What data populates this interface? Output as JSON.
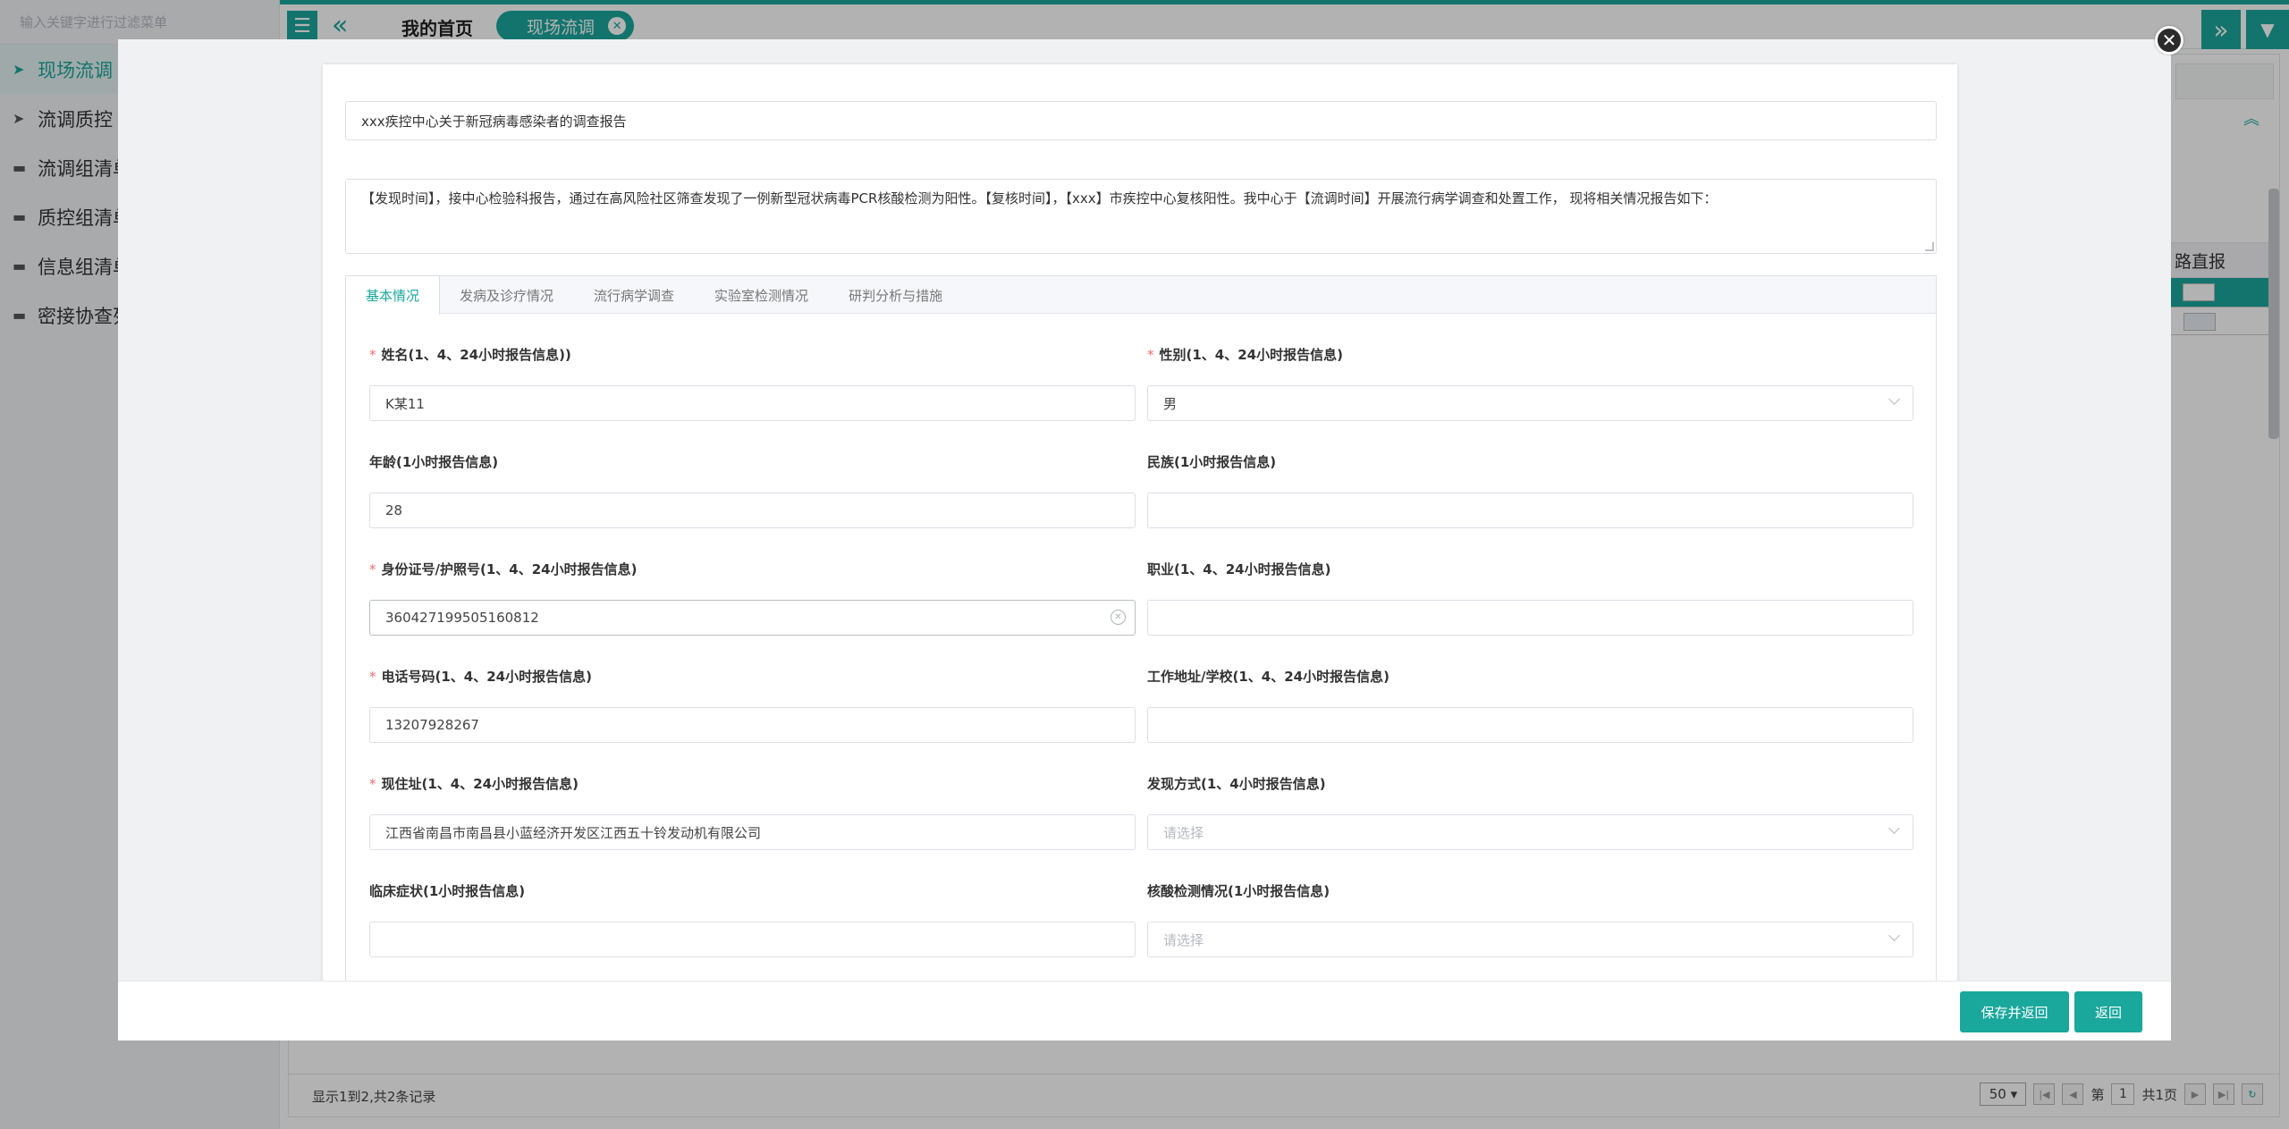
{
  "sidebar": {
    "search_placeholder": "输入关键字进行过滤菜单",
    "items": [
      {
        "label": "现场流调"
      },
      {
        "label": "流调质控"
      },
      {
        "label": "流调组清单"
      },
      {
        "label": "质控组清单"
      },
      {
        "label": "信息组清单"
      },
      {
        "label": "密接协查列"
      }
    ]
  },
  "topbar": {
    "home_tab": "我的首页",
    "active_tab": "现场流调",
    "menu_icon": "☰",
    "back_icon": "«",
    "fwd_icon": "»",
    "dropdown_icon": "▼"
  },
  "background_table": {
    "header_fragment": "路直报"
  },
  "background_footer": {
    "info": "显示1到2,共2条记录",
    "page_size": "50",
    "page_prefix": "第",
    "page_num": "1",
    "page_suffix": "共1页"
  },
  "modal": {
    "title_value": "xxx疾控中心关于新冠病毒感染者的调查报告",
    "intro_value": "【发现时间】，接中心检验科报告，通过在高风险社区筛查发现了一例新型冠状病毒PCR核酸检测为阳性。【复核时间】，【xxx】市疾控中心复核阳性。我中心于【流调时间】开展流行病学调查和处置工作， 现将相关情况报告如下：",
    "tabs": [
      {
        "label": "基本情况"
      },
      {
        "label": "发病及诊疗情况"
      },
      {
        "label": "流行病学调查"
      },
      {
        "label": "实验室检测情况"
      },
      {
        "label": "研判分析与措施"
      }
    ],
    "fields": {
      "name": {
        "label": "姓名(1、4、24小时报告信息))",
        "value": "K某11"
      },
      "gender": {
        "label": "性别(1、4、24小时报告信息)",
        "value": "男"
      },
      "age": {
        "label": "年龄(1小时报告信息)",
        "value": "28"
      },
      "ethnicity": {
        "label": "民族(1小时报告信息)",
        "value": ""
      },
      "id_number": {
        "label": "身份证号/护照号(1、4、24小时报告信息)",
        "value": "360427199505160812"
      },
      "occupation": {
        "label": "职业(1、4、24小时报告信息)",
        "value": ""
      },
      "phone": {
        "label": "电话号码(1、4、24小时报告信息)",
        "value": "13207928267"
      },
      "work_address": {
        "label": "工作地址/学校(1、4、24小时报告信息)",
        "value": ""
      },
      "address": {
        "label": "现住址(1、4、24小时报告信息)",
        "value": "江西省南昌市南昌县小蓝经济开发区江西五十铃发动机有限公司"
      },
      "discovery": {
        "label": "发现方式(1、4小时报告信息)",
        "placeholder": "请选择"
      },
      "symptoms": {
        "label": "临床症状(1小时报告信息)",
        "value": ""
      },
      "nucleic": {
        "label": "核酸检测情况(1小时报告信息)",
        "placeholder": "请选择"
      }
    },
    "save_button": "保存并返回",
    "back_button": "返回"
  },
  "colors": {
    "accent": "#1aa79c",
    "required": "#f56c6c"
  }
}
